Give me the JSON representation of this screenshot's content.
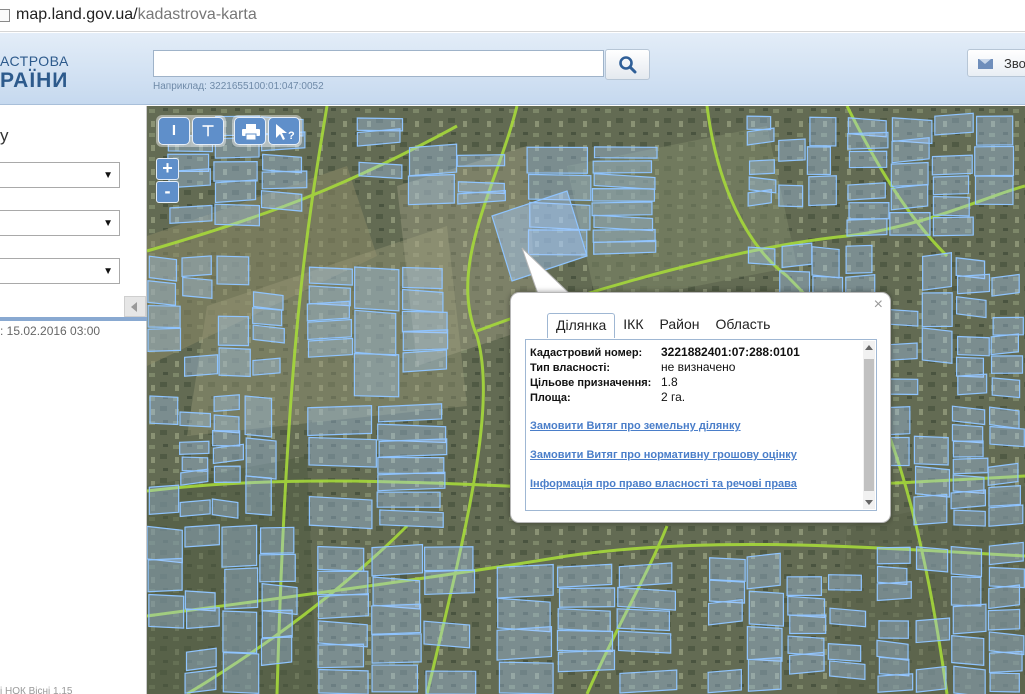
{
  "browser": {
    "url_host": "map.land.gov.ua/",
    "url_path": "kadastrova-karta"
  },
  "header": {
    "logo_line1": "АСТРОВА",
    "logo_line2": "РАЇНИ",
    "search_value": "",
    "search_example": "Наприклад: 3221655100:01:047:0052",
    "feedback_label": "Зво"
  },
  "left_panel": {
    "title": "у",
    "date_text": ": 15.02.2016 03:00",
    "bottom_text": "і НОК Вісні 1.15"
  },
  "map_tools": {
    "ruler_label": "I",
    "area_label": "⊤",
    "print_icon": "printer-icon",
    "info_icon": "pointer-help-icon",
    "zoom_in": "+",
    "zoom_out": "-"
  },
  "popup": {
    "tabs": [
      {
        "label": "Ділянка",
        "active": true
      },
      {
        "label": "ІКК",
        "active": false
      },
      {
        "label": "Район",
        "active": false
      },
      {
        "label": "Область",
        "active": false
      }
    ],
    "fields": [
      {
        "label": "Кадастровий номер:",
        "value": "3221882401:07:288:0101"
      },
      {
        "label": "Тип власності:",
        "value": "не визначено"
      },
      {
        "label": "Цільове призначення:",
        "value": "1.8"
      },
      {
        "label": "Площа:",
        "value": "2 га."
      }
    ],
    "links": [
      "Замовити Витяг про земельну ділянку",
      "Замовити Витяг про нормативну грошову оцінку",
      "Інформація про право власності та речові права"
    ],
    "close_label": "×"
  },
  "colors": {
    "parcel_fill": "#a8cfff",
    "parcel_stroke": "#8fc4ff",
    "road_line": "#a6d93b",
    "tool_blue": "#5f8fca"
  }
}
